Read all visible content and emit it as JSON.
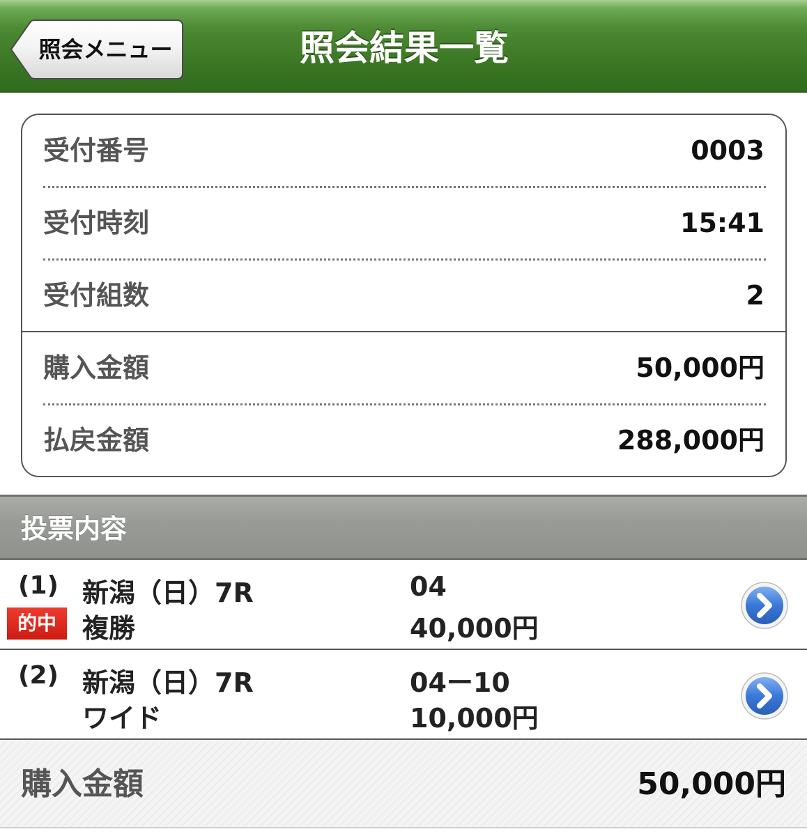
{
  "header": {
    "title": "照会結果一覧",
    "back_label": "照会メニュー"
  },
  "summary": {
    "receipt_number_label": "受付番号",
    "receipt_number_value": "0003",
    "receipt_time_label": "受付時刻",
    "receipt_time_value": "15:41",
    "sets_label": "受付組数",
    "sets_value": "2",
    "purchase_label": "購入金額",
    "purchase_value": "50,000円",
    "payout_label": "払戻金額",
    "payout_value": "288,000円"
  },
  "section": {
    "title": "投票内容"
  },
  "bets": [
    {
      "num": "(1)",
      "race": "新潟（日）7R",
      "type": "複勝",
      "combo": "04",
      "amount": "40,000円",
      "badge": "的中"
    },
    {
      "num": "(2)",
      "race": "新潟（日）7R",
      "type": "ワイド",
      "combo": "04ー10",
      "amount": "10,000円"
    }
  ],
  "footer": {
    "label": "購入金額",
    "value": "50,000円"
  },
  "colors": {
    "header_green": "#3f7a27",
    "hit_red": "#d6241a",
    "chevron_blue": "#3a78d8",
    "section_gray": "#979a95"
  }
}
